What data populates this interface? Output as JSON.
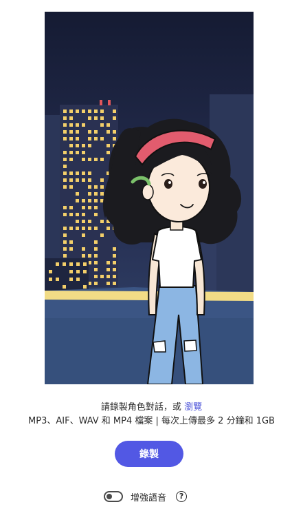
{
  "character_scene": {
    "icon": "cartoon-character-city-night-illustration"
  },
  "instructions": {
    "prompt_text": "請錄製角色對話，或",
    "browse_link": "瀏覽",
    "formats_text": "MP3、AIF、WAV 和 MP4 檔案 | 每次上傳最多 2 分鐘和 1GB"
  },
  "record_button": {
    "label": "錄製"
  },
  "enhance_speech": {
    "label": "增強語音",
    "enabled": false,
    "help_icon": "?"
  },
  "colors": {
    "accent": "#5258e4",
    "link": "#4b52d8",
    "sky_top": "#161c34",
    "sky_bottom": "#33466e"
  }
}
